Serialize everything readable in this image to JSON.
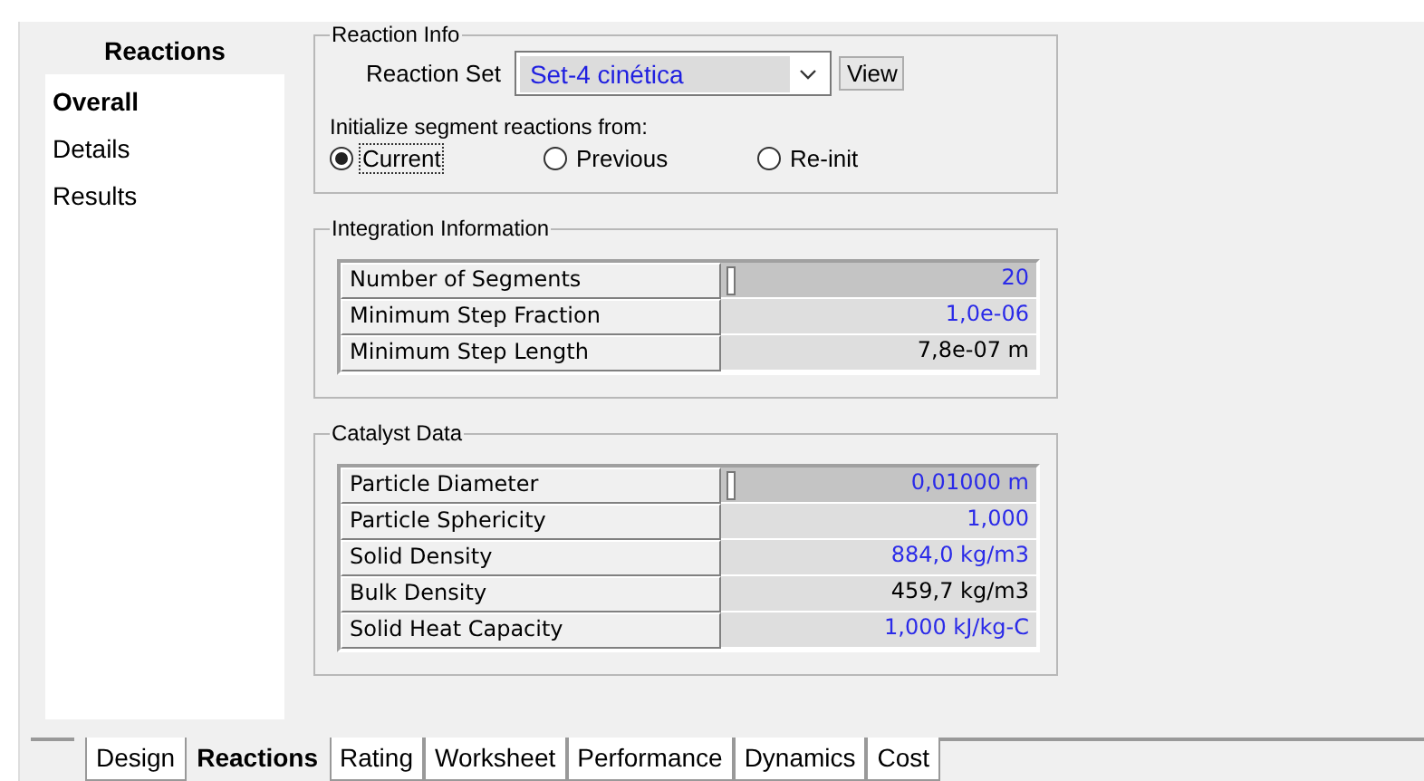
{
  "sidebar": {
    "title": "Reactions",
    "items": [
      {
        "label": "Overall",
        "selected": true
      },
      {
        "label": "Details",
        "selected": false
      },
      {
        "label": "Results",
        "selected": false
      }
    ]
  },
  "reaction_info": {
    "title": "Reaction Info",
    "reaction_set": {
      "label": "Reaction Set",
      "value": "Set-4 cinética"
    },
    "view_button": "View",
    "init_label": "Initialize segment reactions from:",
    "options": [
      {
        "label": "Current",
        "selected": true
      },
      {
        "label": "Previous",
        "selected": false
      },
      {
        "label": "Re-init",
        "selected": false
      }
    ]
  },
  "integration": {
    "title": "Integration Information",
    "rows": [
      {
        "name": "Number of Segments",
        "value": "20",
        "user_specified": true,
        "selected": true
      },
      {
        "name": "Minimum Step Fraction",
        "value": "1,0e-06",
        "user_specified": true,
        "selected": false
      },
      {
        "name": "Minimum Step Length",
        "value": "7,8e-07 m",
        "user_specified": false,
        "selected": false
      }
    ]
  },
  "catalyst": {
    "title": "Catalyst Data",
    "rows": [
      {
        "name": "Particle Diameter",
        "value": "0,01000 m",
        "user_specified": true,
        "selected": true
      },
      {
        "name": "Particle Sphericity",
        "value": "1,000",
        "user_specified": true,
        "selected": false
      },
      {
        "name": "Solid Density",
        "value": "884,0 kg/m3",
        "user_specified": true,
        "selected": false
      },
      {
        "name": "Bulk Density",
        "value": "459,7 kg/m3",
        "user_specified": false,
        "selected": false
      },
      {
        "name": "Solid Heat Capacity",
        "value": "1,000 kJ/kg-C",
        "user_specified": true,
        "selected": false
      }
    ]
  },
  "tabs": [
    {
      "label": "Design",
      "selected": false
    },
    {
      "label": "Reactions",
      "selected": true
    },
    {
      "label": "Rating",
      "selected": false
    },
    {
      "label": "Worksheet",
      "selected": false
    },
    {
      "label": "Performance",
      "selected": false
    },
    {
      "label": "Dynamics",
      "selected": false
    },
    {
      "label": "Cost",
      "selected": false
    }
  ]
}
